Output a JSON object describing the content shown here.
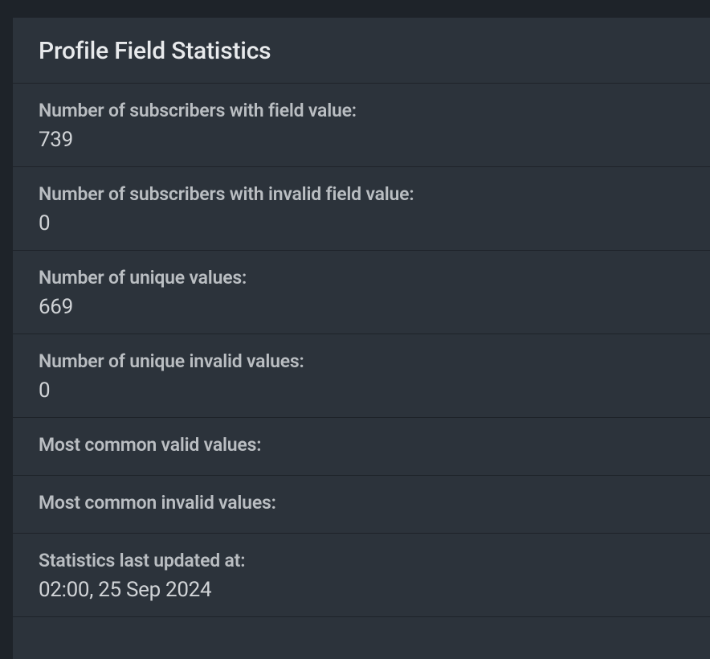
{
  "panel": {
    "title": "Profile Field Statistics",
    "stats": [
      {
        "label": "Number of subscribers with field value:",
        "value": "739"
      },
      {
        "label": "Number of subscribers with invalid field value:",
        "value": "0"
      },
      {
        "label": "Number of unique values:",
        "value": "669"
      },
      {
        "label": "Number of unique invalid values:",
        "value": "0"
      },
      {
        "label": "Most common valid values:",
        "value": ""
      },
      {
        "label": "Most common invalid values:",
        "value": ""
      },
      {
        "label": "Statistics last updated at:",
        "value": "02:00, 25 Sep 2024"
      }
    ]
  }
}
